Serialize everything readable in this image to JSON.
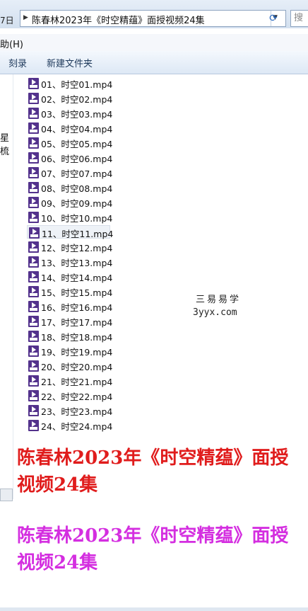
{
  "address_bar": {
    "left_crumb": "7日",
    "path": "陈春林2023年《时空精蕴》面授视频24集",
    "search_placeholder": "搜"
  },
  "menu": {
    "help": "助(H)"
  },
  "toolbar": {
    "burn": "刻录",
    "new_folder": "新建文件夹"
  },
  "nav_pane": {
    "partial_text": "星梳"
  },
  "files": [
    "01、时空01.mp4",
    "02、时空02.mp4",
    "03、时空03.mp4",
    "04、时空04.mp4",
    "05、时空05.mp4",
    "06、时空06.mp4",
    "07、时空07.mp4",
    "08、时空08.mp4",
    "09、时空09.mp4",
    "10、时空10.mp4",
    "11、时空11.mp4",
    "12、时空12.mp4",
    "13、时空13.mp4",
    "14、时空14.mp4",
    "15、时空15.mp4",
    "16、时空16.mp4",
    "17、时空17.mp4",
    "18、时空18.mp4",
    "19、时空19.mp4",
    "20、时空20.mp4",
    "21、时空21.mp4",
    "22、时空22.mp4",
    "23、时空23.mp4",
    "24、时空24.mp4"
  ],
  "selected_file_index": 10,
  "watermark": {
    "line1": "三易易学",
    "line2": "3yyx.com"
  },
  "captions": {
    "red": "陈春林2023年《时空精蕴》面授视频24集",
    "pink": "陈春林2023年《时空精蕴》面授视频24集"
  },
  "colors": {
    "caption_red": "#e01c1c",
    "caption_pink": "#d42ee0",
    "file_icon": "#53328c"
  }
}
